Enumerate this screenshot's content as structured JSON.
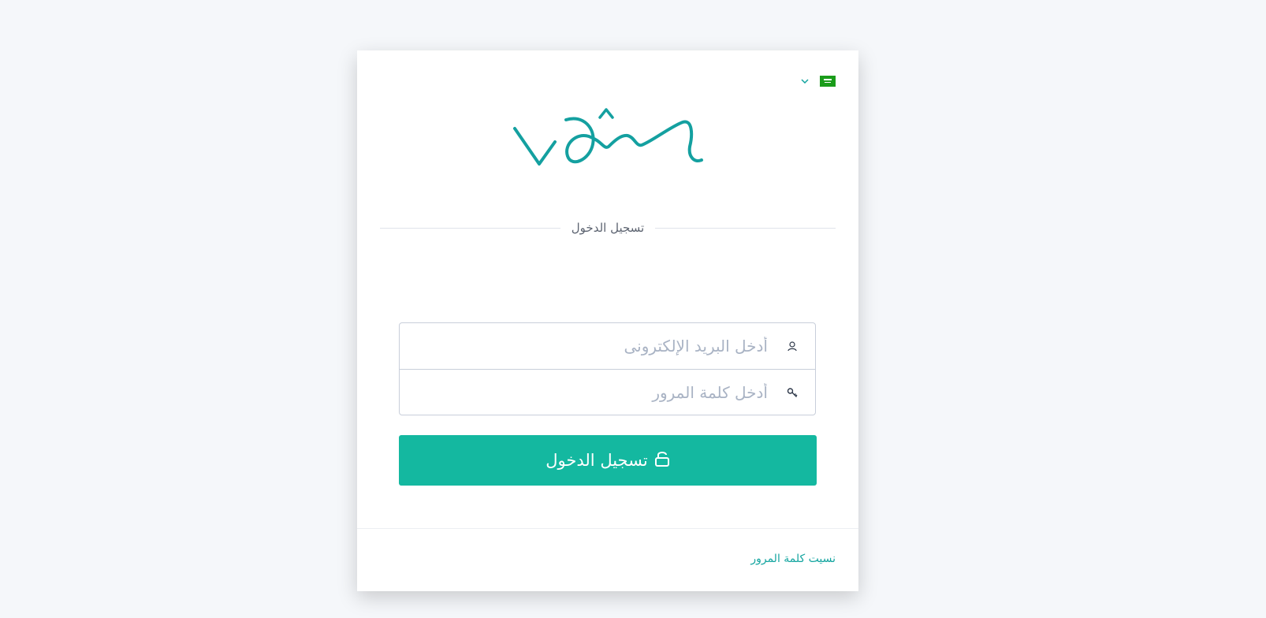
{
  "header": {
    "language_flag_icon": "saudi-flag-icon",
    "language_dropdown_icon": "chevron-down-icon",
    "logo_icon": "vom-logo"
  },
  "login": {
    "title": "تسجيل الدخول",
    "email_placeholder": "أدخل البريد الإلكترونى",
    "password_placeholder": "أدخل كلمة المرور",
    "email_icon": "user-icon",
    "password_icon": "key-icon",
    "submit_label": "تسجيل الدخول",
    "submit_icon": "unlock-icon"
  },
  "footer": {
    "forgot_password": "نسيت كلمة المرور"
  },
  "colors": {
    "accent": "#14b8a0",
    "logo": "#14a0a0",
    "link": "#14a5a0",
    "flag": "#1a9c1a"
  }
}
